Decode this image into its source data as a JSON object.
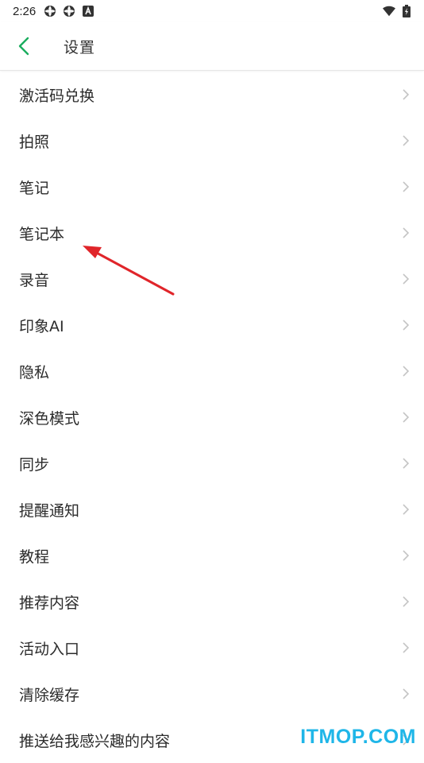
{
  "status_bar": {
    "time": "2:26",
    "icons": [
      "sync-icon",
      "sync-icon",
      "notification-a-icon"
    ],
    "right_icons": [
      "wifi-icon",
      "battery-icon"
    ]
  },
  "header": {
    "title": "设置",
    "back_icon": "chevron-left-icon"
  },
  "settings": {
    "items": [
      {
        "label": "激活码兑换"
      },
      {
        "label": "拍照"
      },
      {
        "label": "笔记"
      },
      {
        "label": "笔记本"
      },
      {
        "label": "录音"
      },
      {
        "label": "印象AI"
      },
      {
        "label": "隐私"
      },
      {
        "label": "深色模式"
      },
      {
        "label": "同步"
      },
      {
        "label": "提醒通知"
      },
      {
        "label": "教程"
      },
      {
        "label": "推荐内容"
      },
      {
        "label": "活动入口"
      },
      {
        "label": "清除缓存"
      },
      {
        "label": "推送给我感兴趣的内容"
      }
    ]
  },
  "colors": {
    "accent": "#1aad5e",
    "annotation_arrow": "#e0252a",
    "watermark": "#1fb6e8",
    "chevron": "#c4c4c4"
  },
  "watermark": {
    "text": "ITMOP.COM"
  }
}
